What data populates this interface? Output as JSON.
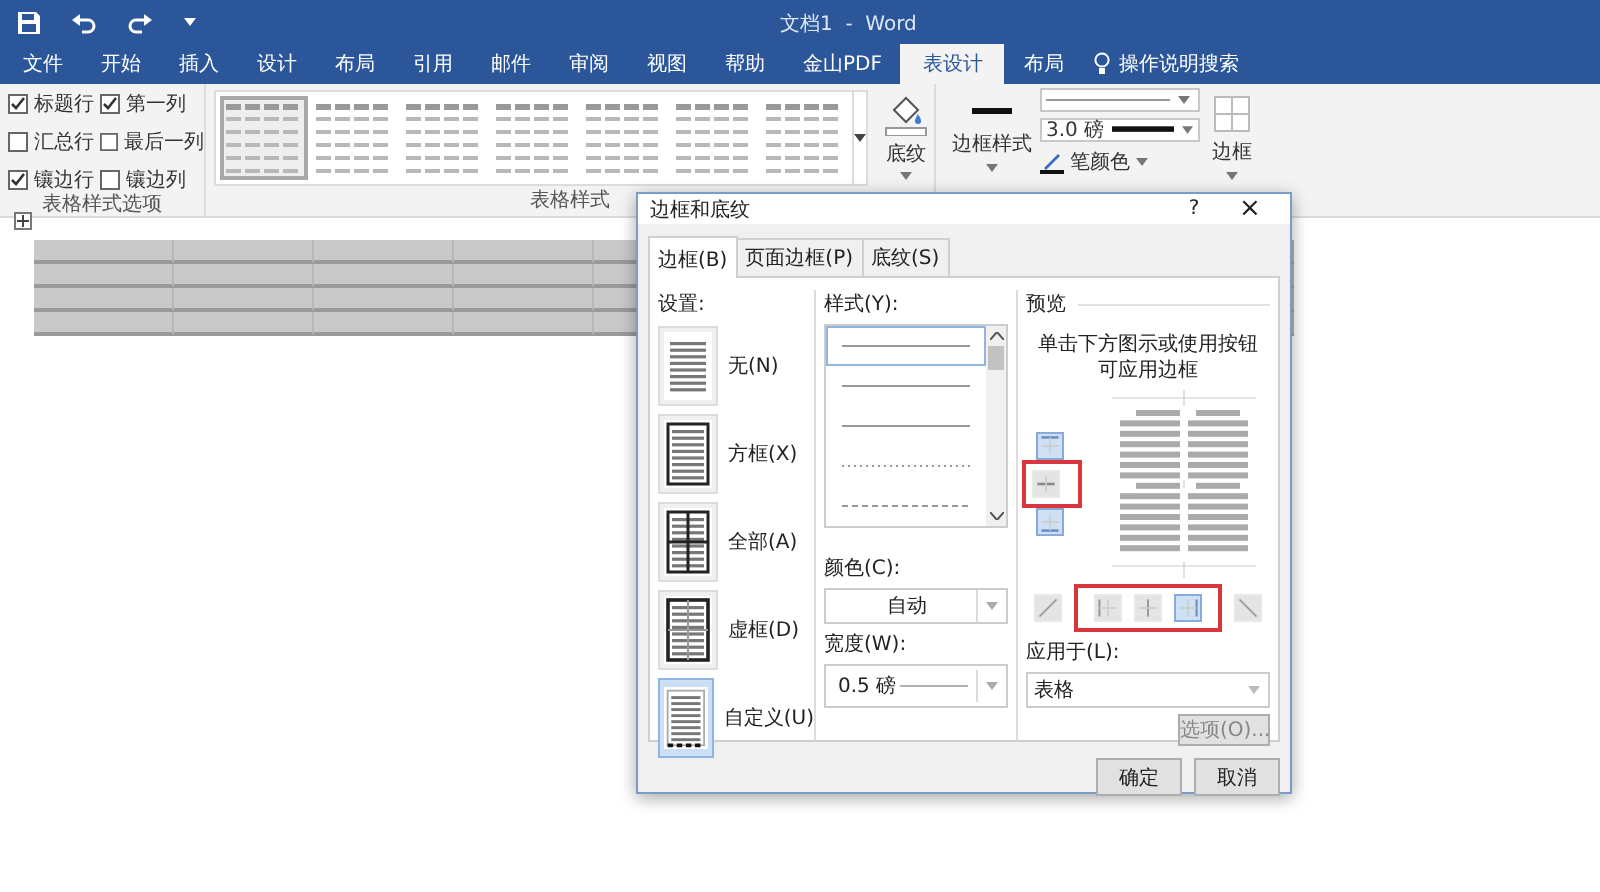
{
  "window": {
    "title": "文档1  -  Word"
  },
  "ribbon_tabs": [
    {
      "label": "文件",
      "selected": false
    },
    {
      "label": "开始",
      "selected": false
    },
    {
      "label": "插入",
      "selected": false
    },
    {
      "label": "设计",
      "selected": false
    },
    {
      "label": "布局",
      "selected": false
    },
    {
      "label": "引用",
      "selected": false
    },
    {
      "label": "邮件",
      "selected": false
    },
    {
      "label": "审阅",
      "selected": false
    },
    {
      "label": "视图",
      "selected": false
    },
    {
      "label": "帮助",
      "selected": false
    },
    {
      "label": "金山PDF",
      "selected": false
    },
    {
      "label": "表设计",
      "selected": true
    },
    {
      "label": "布局",
      "selected": false
    }
  ],
  "tell_me": {
    "label": "操作说明搜索"
  },
  "style_options": {
    "group_label": "表格样式选项",
    "items": [
      {
        "label": "标题行",
        "checked": true
      },
      {
        "label": "第一列",
        "checked": true
      },
      {
        "label": "汇总行",
        "checked": false
      },
      {
        "label": "最后一列",
        "checked": false
      },
      {
        "label": "镶边行",
        "checked": true
      },
      {
        "label": "镶边列",
        "checked": false
      }
    ]
  },
  "table_styles": {
    "group_label": "表格样式",
    "gallery": [
      {
        "selected": true
      },
      {
        "selected": false
      },
      {
        "selected": false
      },
      {
        "selected": false
      },
      {
        "selected": false
      },
      {
        "selected": false
      },
      {
        "selected": false
      }
    ],
    "shading_label": "底纹"
  },
  "borders_group": {
    "border_styles_label": "边框样式",
    "pen_weight": "3.0 磅",
    "pen_color_label": "笔颜色",
    "borders_label": "边框"
  },
  "dialog": {
    "title": "边框和底纹",
    "help": "?",
    "close": "×",
    "tabs": [
      {
        "label": "边框(B)",
        "selected": true
      },
      {
        "label": "页面边框(P)",
        "selected": false
      },
      {
        "label": "底纹(S)",
        "selected": false
      }
    ],
    "settings_label": "设置:",
    "settings": [
      {
        "kind": "none",
        "label": "无(N)",
        "selected": false
      },
      {
        "kind": "box",
        "label": "方框(X)",
        "selected": false
      },
      {
        "kind": "all",
        "label": "全部(A)",
        "selected": false
      },
      {
        "kind": "grid",
        "label": "虚框(D)",
        "selected": false
      },
      {
        "kind": "custom",
        "label": "自定义(U)",
        "selected": true
      }
    ],
    "style_label": "样式(Y):",
    "line_styles": [
      {
        "kind": "solid",
        "selected": true
      },
      {
        "kind": "solid",
        "selected": false
      },
      {
        "kind": "solid",
        "selected": false
      },
      {
        "kind": "dotted",
        "selected": false
      },
      {
        "kind": "dashed",
        "selected": false
      }
    ],
    "color_label": "颜色(C):",
    "color_value": "自动",
    "width_label": "宽度(W):",
    "width_value": "0.5 磅",
    "preview_label": "预览",
    "preview_hint": "单击下方图示或使用按钮可应用边框",
    "border_buttons": [
      {
        "kind": "top",
        "pressed": true
      },
      {
        "kind": "inside-h",
        "pressed": false
      },
      {
        "kind": "bottom",
        "pressed": true
      },
      {
        "kind": "diag-up",
        "pressed": false
      },
      {
        "kind": "left",
        "pressed": false
      },
      {
        "kind": "inside-v",
        "pressed": false
      },
      {
        "kind": "right",
        "pressed": true
      },
      {
        "kind": "diag-down",
        "pressed": false
      }
    ],
    "apply_to_label": "应用于(L):",
    "apply_to_value": "表格",
    "options_button": "选项(O)...",
    "ok_button": "确定",
    "cancel_button": "取消"
  }
}
